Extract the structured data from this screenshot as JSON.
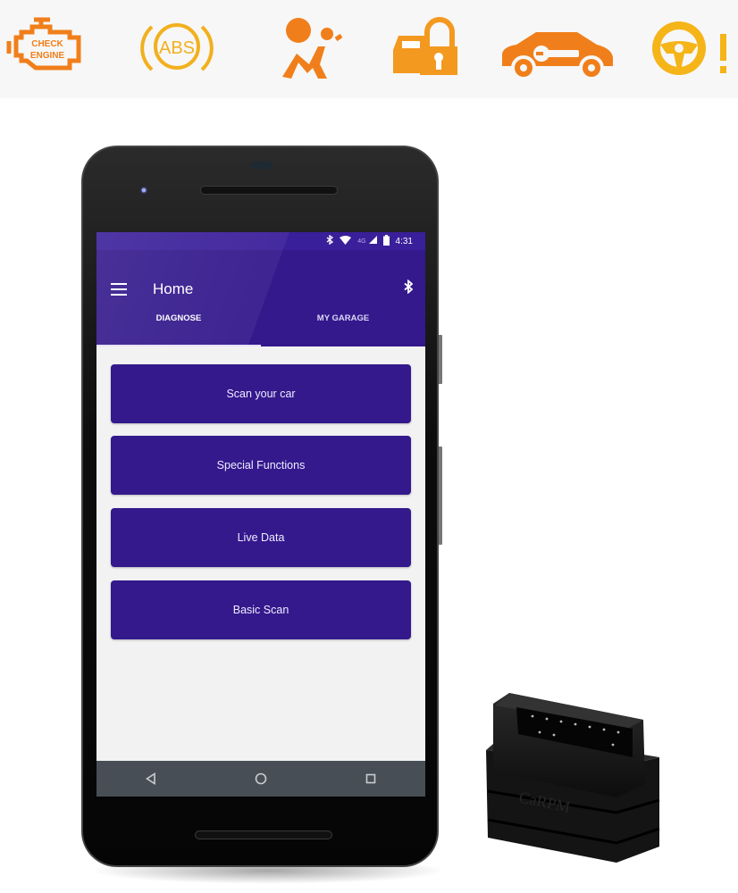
{
  "warning_icons": [
    {
      "name": "check-engine-icon",
      "label": "CHECK ENGINE",
      "color": "#f07f1b"
    },
    {
      "name": "abs-icon",
      "label": "ABS",
      "color": "#f2b01e"
    },
    {
      "name": "airbag-icon",
      "label": "",
      "color": "#f07f1b"
    },
    {
      "name": "car-lock-icon",
      "label": "",
      "color": "#f4991f"
    },
    {
      "name": "car-service-icon",
      "label": "",
      "color": "#f07f1b"
    },
    {
      "name": "steering-warning-icon",
      "label": "!",
      "color": "#f5b418"
    }
  ],
  "status_bar": {
    "icons": [
      "bluetooth-icon",
      "wifi-icon",
      "4g-icon",
      "signal-icon",
      "battery-icon"
    ],
    "network": "4G",
    "time": "4:31"
  },
  "app_bar": {
    "title": "Home",
    "menu_icon": "hamburger-menu-icon",
    "action_icon": "bluetooth-icon"
  },
  "tabs": [
    {
      "label": "DIAGNOSE",
      "active": true
    },
    {
      "label": "MY GARAGE",
      "active": false
    }
  ],
  "actions": [
    {
      "label": "Scan your car"
    },
    {
      "label": "Special Functions"
    },
    {
      "label": "Live Data"
    },
    {
      "label": "Basic Scan"
    }
  ],
  "nav_bar": {
    "back": "back-triangle-icon",
    "home": "home-circle-icon",
    "recents": "recents-square-icon"
  },
  "device": {
    "brand": "CaRPM"
  },
  "colors": {
    "primary": "#33198c",
    "status_bar": "#3a1f9a",
    "screen_bg": "#f2f2f2",
    "nav_bar": "#474e55",
    "warning_orange": "#f07f1b",
    "warning_amber": "#f2b01e"
  }
}
